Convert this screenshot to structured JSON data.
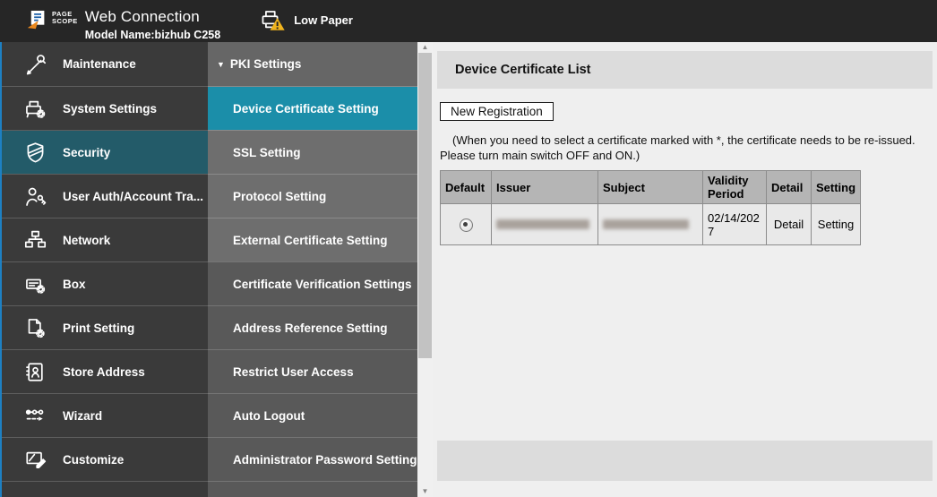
{
  "header": {
    "logo": {
      "icon": "pagescope-logo-icon",
      "line1": "PAGE",
      "line2": "SCOPE"
    },
    "app_title": "Web Connection",
    "model_name": "Model Name:bizhub C258",
    "status": {
      "icon": "low-paper-warning-icon",
      "label": "Low Paper"
    }
  },
  "sidebar": {
    "items": [
      {
        "label": "Maintenance",
        "icon": "maintenance-icon",
        "selected": false
      },
      {
        "label": "System Settings",
        "icon": "system-settings-icon",
        "selected": false
      },
      {
        "label": "Security",
        "icon": "security-shield-icon",
        "selected": true
      },
      {
        "label": "User Auth/Account Tra...",
        "icon": "user-auth-key-icon",
        "selected": false
      },
      {
        "label": "Network",
        "icon": "network-icon",
        "selected": false
      },
      {
        "label": "Box",
        "icon": "box-icon",
        "selected": false
      },
      {
        "label": "Print Setting",
        "icon": "print-setting-icon",
        "selected": false
      },
      {
        "label": "Store Address",
        "icon": "store-address-icon",
        "selected": false
      },
      {
        "label": "Wizard",
        "icon": "wizard-icon",
        "selected": false
      },
      {
        "label": "Customize",
        "icon": "customize-icon",
        "selected": false
      }
    ]
  },
  "submenu": {
    "header": {
      "marker": "▼",
      "label": "PKI Settings"
    },
    "items": [
      {
        "label": "Device Certificate Setting",
        "selected": true,
        "shade": "light"
      },
      {
        "label": "SSL Setting",
        "selected": false,
        "shade": "light"
      },
      {
        "label": "Protocol Setting",
        "selected": false,
        "shade": "light"
      },
      {
        "label": "External Certificate Setting",
        "selected": false,
        "shade": "light"
      },
      {
        "label": "Certificate Verification Settings",
        "selected": false,
        "shade": "dark"
      },
      {
        "label": "Address Reference Setting",
        "selected": false,
        "shade": "dark"
      },
      {
        "label": "Restrict User Access",
        "selected": false,
        "shade": "dark"
      },
      {
        "label": "Auto Logout",
        "selected": false,
        "shade": "dark"
      },
      {
        "label": "Administrator Password Setting",
        "selected": false,
        "shade": "dark"
      }
    ],
    "scrollbar": {
      "up_arrow": "▲",
      "down_arrow": "▼"
    }
  },
  "main": {
    "title": "Device Certificate List",
    "new_registration_button": "New Registration",
    "note_line1": "(When you need to select a certificate marked with *, the certificate needs to be re-issued.",
    "note_line2": "Please turn main switch OFF and ON.)",
    "table": {
      "headers": [
        "Default",
        "Issuer",
        "Subject",
        "Validity Period",
        "Detail",
        "Setting"
      ],
      "row": {
        "default_selected": true,
        "issuer_redacted": true,
        "subject_redacted": true,
        "validity_period": "02/14/2027",
        "detail": "Detail",
        "setting": "Setting"
      }
    }
  },
  "colors": {
    "header_bg": "#262626",
    "sidebar_bg": "#3a3a3a",
    "sidebar_selected_teal": "#235b69",
    "submenu_selected_teal": "#1b8ea9",
    "submenu_light": "#6e6e6e",
    "submenu_dark": "#595959",
    "edge_blue": "#1d80c3",
    "warning_yellow": "#f0b41e",
    "band_gray": "#dcdcdc",
    "table_header_gray": "#b5b5b5"
  }
}
